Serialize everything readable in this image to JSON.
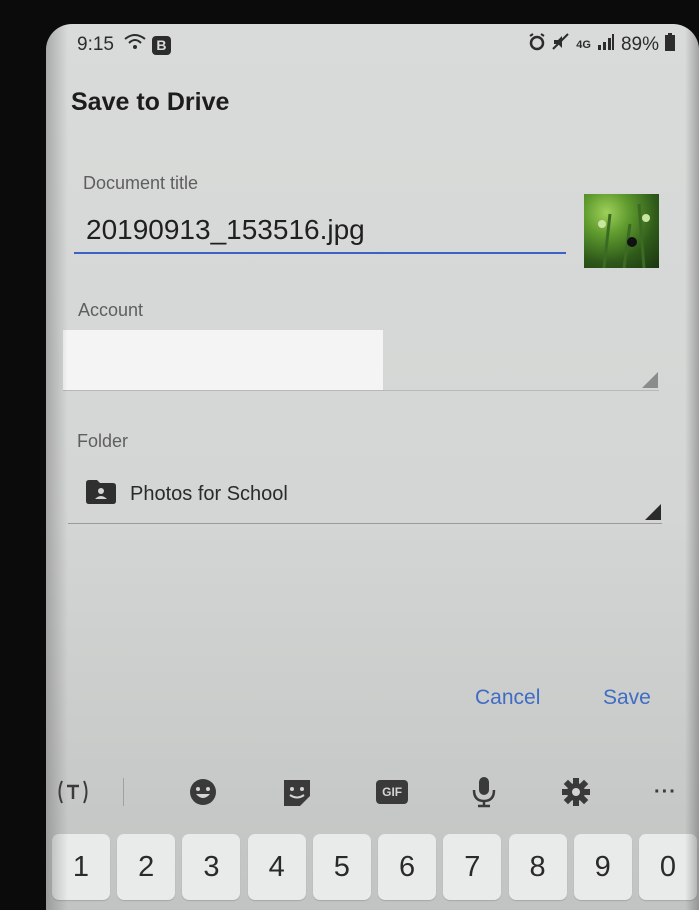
{
  "status_bar": {
    "time": "9:15",
    "badge": "B",
    "network": "4G",
    "battery": "89%"
  },
  "dialog": {
    "title": "Save to Drive",
    "document_title_label": "Document title",
    "document_title_value": "20190913_153516.jpg",
    "account_label": "Account",
    "folder_label": "Folder",
    "folder_value": "Photos for School",
    "cancel_label": "Cancel",
    "save_label": "Save"
  },
  "keyboard": {
    "toolbar": {
      "gif_label": "GIF",
      "more_label": "···"
    },
    "number_keys": [
      "1",
      "2",
      "3",
      "4",
      "5",
      "6",
      "7",
      "8",
      "9",
      "0"
    ]
  },
  "colors": {
    "accent": "#3f6cc5",
    "input_underline": "#3b62c4"
  }
}
